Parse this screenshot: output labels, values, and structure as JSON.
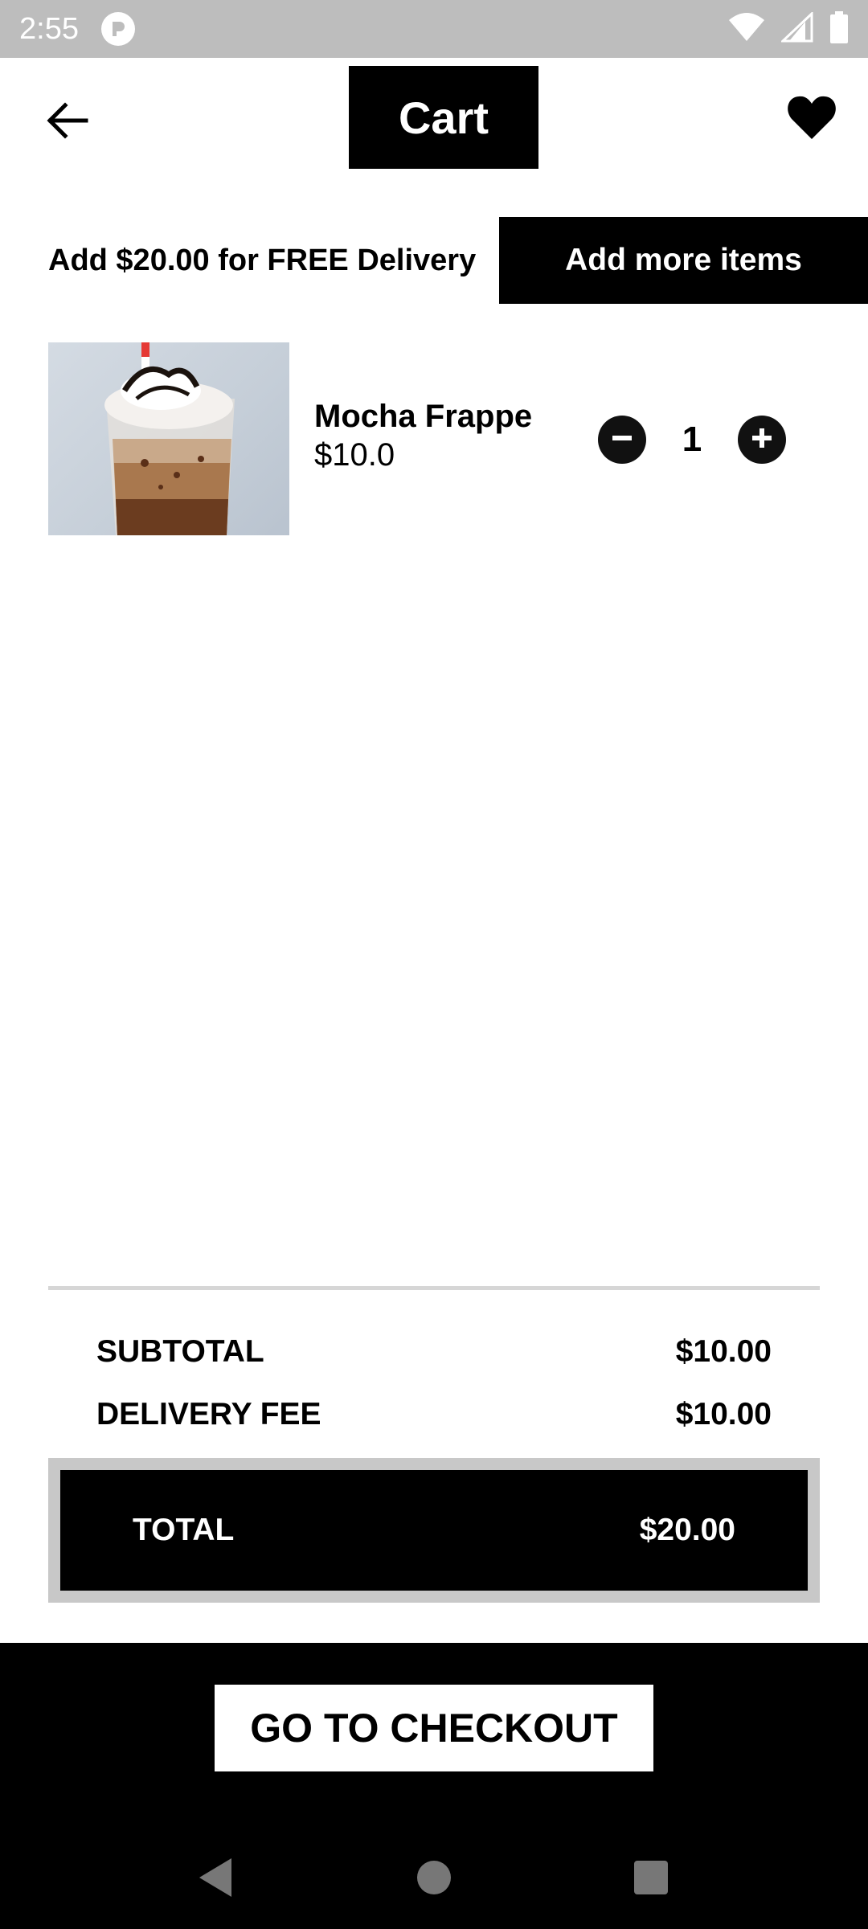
{
  "status_bar": {
    "time": "2:55",
    "icons": [
      "app-notification-icon",
      "wifi-icon",
      "cell-signal-icon",
      "battery-icon"
    ]
  },
  "header": {
    "title": "Cart",
    "back_icon": "arrow-left-icon",
    "favorite_icon": "heart-icon"
  },
  "delivery_banner": {
    "message": "Add $20.00 for FREE Delivery",
    "button_label": "Add more items"
  },
  "cart": {
    "items": [
      {
        "name": "Mocha Frappe",
        "price": "$10.0",
        "quantity": "1",
        "image": "mocha-frappe-photo"
      }
    ]
  },
  "summary": {
    "subtotal_label": "SUBTOTAL",
    "subtotal_value": "$10.00",
    "delivery_label": "DELIVERY FEE",
    "delivery_value": "$10.00",
    "total_label": "TOTAL",
    "total_value": "$20.00"
  },
  "checkout": {
    "button_label": "GO TO CHECKOUT"
  },
  "nav": {
    "icons": [
      "nav-back-icon",
      "nav-home-icon",
      "nav-recents-icon"
    ]
  },
  "colors": {
    "primary": "#000000",
    "on_primary": "#ffffff",
    "status_bar": "#bdbdbd",
    "divider": "#d6d6d6",
    "total_border": "#c8c8c8"
  }
}
